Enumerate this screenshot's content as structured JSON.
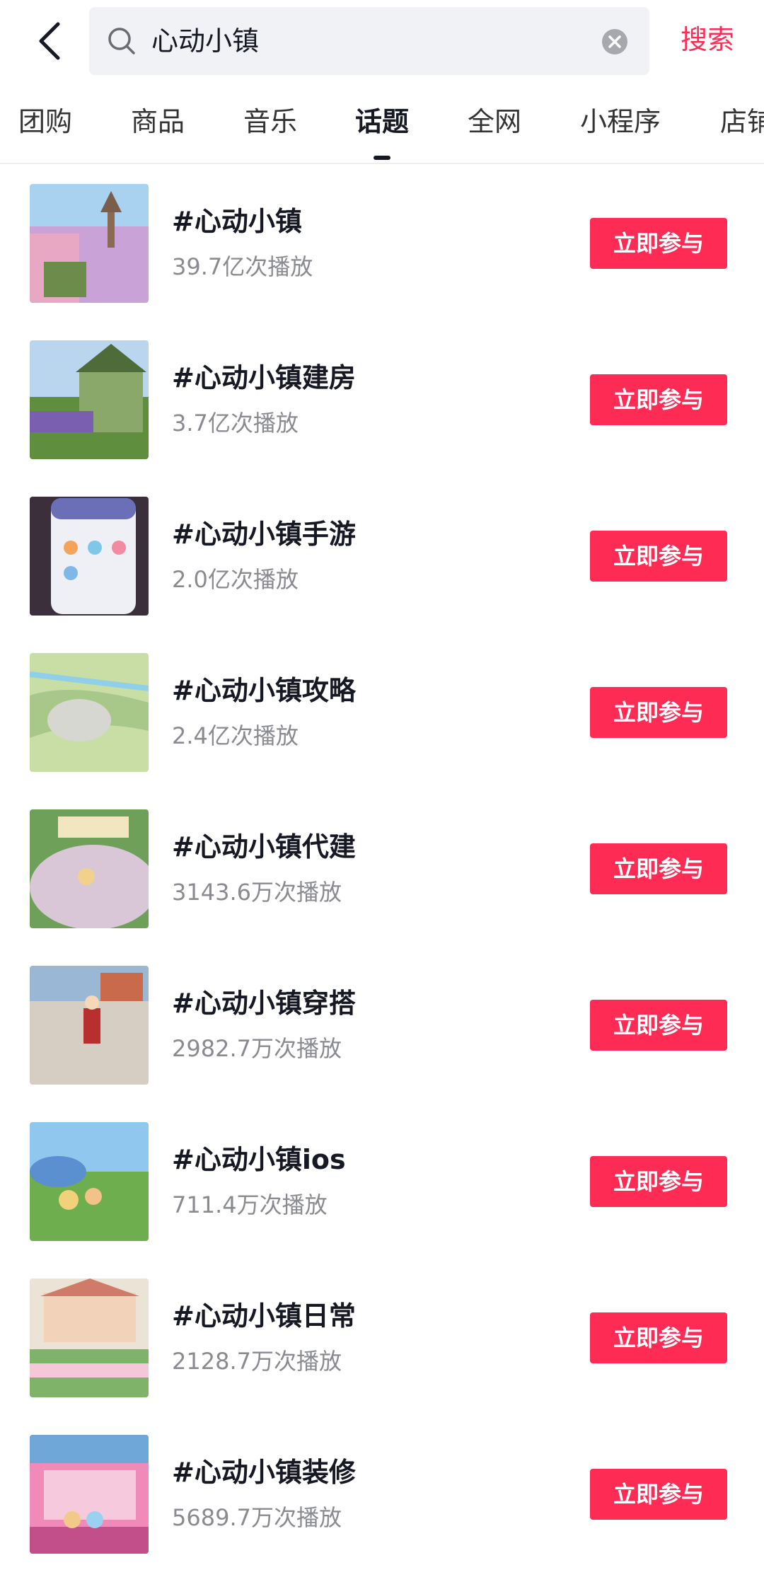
{
  "search": {
    "query": "心动小镇",
    "button": "搜索"
  },
  "tabs": [
    {
      "label": "团购"
    },
    {
      "label": "商品"
    },
    {
      "label": "音乐"
    },
    {
      "label": "话题"
    },
    {
      "label": "全网"
    },
    {
      "label": "小程序"
    },
    {
      "label": "店铺"
    }
  ],
  "active_tab": "话题",
  "topics": [
    {
      "title": "#心动小镇",
      "plays": "39.7亿次播放",
      "button": "立即参与"
    },
    {
      "title": "#心动小镇建房",
      "plays": "3.7亿次播放",
      "button": "立即参与"
    },
    {
      "title": "#心动小镇手游",
      "plays": "2.0亿次播放",
      "button": "立即参与"
    },
    {
      "title": "#心动小镇攻略",
      "plays": "2.4亿次播放",
      "button": "立即参与"
    },
    {
      "title": "#心动小镇代建",
      "plays": "3143.6万次播放",
      "button": "立即参与"
    },
    {
      "title": "#心动小镇穿搭",
      "plays": "2982.7万次播放",
      "button": "立即参与"
    },
    {
      "title": "#心动小镇ios",
      "plays": "711.4万次播放",
      "button": "立即参与"
    },
    {
      "title": "#心动小镇日常",
      "plays": "2128.7万次播放",
      "button": "立即参与"
    },
    {
      "title": "#心动小镇装修",
      "plays": "5689.7万次播放",
      "button": "立即参与"
    }
  ],
  "colors": {
    "accent": "#fe2c55",
    "text_primary": "#161823",
    "text_secondary": "#8a8b91",
    "search_bg": "#f1f2f5"
  }
}
